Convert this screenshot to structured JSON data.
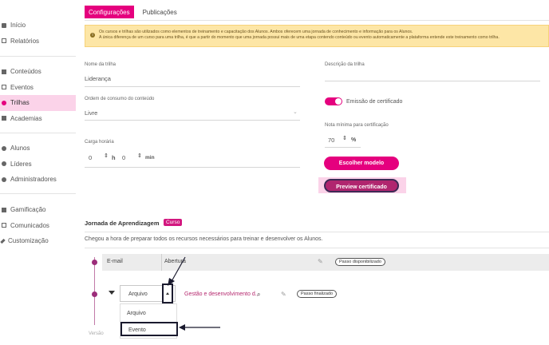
{
  "sidebar": {
    "group1": [
      {
        "label": "Início",
        "icon": "home-icon"
      },
      {
        "label": "Relatórios",
        "icon": "chart-icon"
      }
    ],
    "group2": [
      {
        "label": "Conteúdos",
        "icon": "content-icon"
      },
      {
        "label": "Eventos",
        "icon": "calendar-icon"
      },
      {
        "label": "Trilhas",
        "icon": "trail-icon",
        "active": true
      },
      {
        "label": "Academias",
        "icon": "academy-icon"
      }
    ],
    "group3": [
      {
        "label": "Alunos",
        "icon": "user-icon"
      },
      {
        "label": "Líderes",
        "icon": "leader-icon"
      },
      {
        "label": "Administradores",
        "icon": "admin-icon"
      }
    ],
    "group4": [
      {
        "label": "Gamificação",
        "icon": "game-icon"
      },
      {
        "label": "Comunicados",
        "icon": "message-icon"
      },
      {
        "label": "Customização",
        "icon": "brush-icon"
      }
    ]
  },
  "tabs": [
    {
      "label": "Configurações",
      "active": true
    },
    {
      "label": "Publicações",
      "active": false
    }
  ],
  "banner": {
    "line1": "Os cursos e trilhas são utilizados como elementos de treinamento e capacitação dos Alunos. Ambos oferecem uma jornada de conhecimento e informação para os Alunos.",
    "line2": "A única diferença de um curso para uma trilha, é que a partir do momento que uma jornada possui mais de uma etapa contendo conteúdo ou evento automaticamente a plataforma entende este treinamento como trilha."
  },
  "form": {
    "name_label": "Nome da trilha",
    "name_value": "Liderança",
    "desc_label": "Descrição da trilha",
    "order_label": "Ordem de consumo do conteúdo",
    "order_value": "Livre",
    "cert_label": "Emissão de certificado",
    "min_grade_label": "Nota mínima para certificação",
    "min_grade_value": "70",
    "min_grade_unit": "%",
    "hours_label": "Carga horária",
    "hours_value": "0",
    "hours_unit": "h",
    "min_value": "0",
    "min_unit": "min",
    "choose_model": "Escolher modelo",
    "preview_cert": "Preview certificado"
  },
  "journey": {
    "title": "Jornada de Aprendizagem",
    "badge": "Curso",
    "subtitle": "Chegou a hora de preparar todos os recursos necessários para treinar e desenvolver os Alunos.",
    "row1": {
      "col1": "E-mail",
      "col2": "Abertura",
      "status": "Passo disponibilizado"
    },
    "row2": {
      "select_value": "Arquivo",
      "link": "Gestão e desenvolvimento d...",
      "status": "Passo finalizado"
    },
    "dropdown_options": [
      "Arquivo",
      "Evento"
    ]
  },
  "footer": {
    "version": "Versão"
  }
}
